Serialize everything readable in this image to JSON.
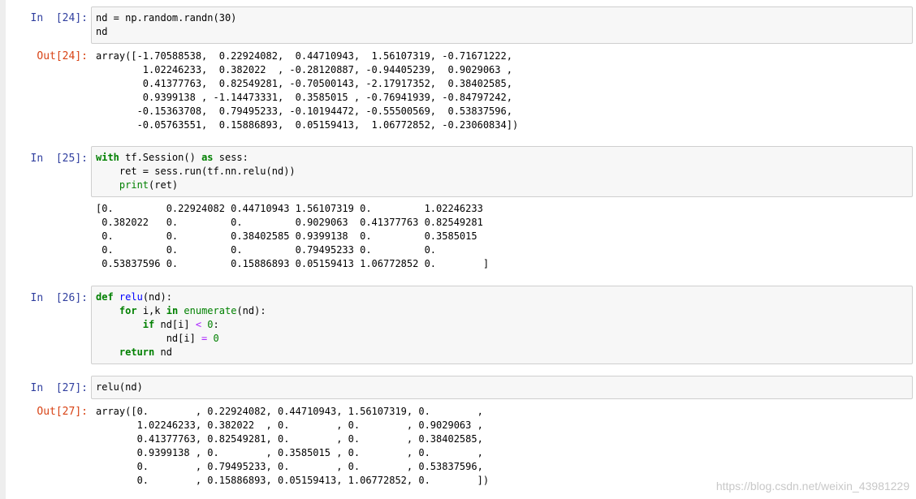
{
  "cells": [
    {
      "in_prompt": "In  [24]:",
      "code": [
        "nd = np.random.randn(30)",
        "nd"
      ],
      "out_prompt": "Out[24]:",
      "output": [
        "array([-1.70588538,  0.22924082,  0.44710943,  1.56107319, -0.71671222,",
        "        1.02246233,  0.382022  , -0.28120887, -0.94405239,  0.9029063 ,",
        "        0.41377763,  0.82549281, -0.70500143, -2.17917352,  0.38402585,",
        "        0.9399138 , -1.14473331,  0.3585015 , -0.76941939, -0.84797242,",
        "       -0.15363708,  0.79495233, -0.10194472, -0.55500569,  0.53837596,",
        "       -0.05763551,  0.15886893,  0.05159413,  1.06772852, -0.23060834])"
      ]
    },
    {
      "in_prompt": "In  [25]:",
      "code": [
        "with tf.Session() as sess:",
        "    ret = sess.run(tf.nn.relu(nd))",
        "    print(ret)"
      ],
      "output": [
        "[0.         0.22924082 0.44710943 1.56107319 0.         1.02246233",
        " 0.382022   0.         0.         0.9029063  0.41377763 0.82549281",
        " 0.         0.         0.38402585 0.9399138  0.         0.3585015",
        " 0.         0.         0.         0.79495233 0.         0.",
        " 0.53837596 0.         0.15886893 0.05159413 1.06772852 0.        ]"
      ]
    },
    {
      "in_prompt": "In  [26]:",
      "code": [
        "def relu(nd):",
        "    for i,k in enumerate(nd):",
        "        if nd[i] < 0:",
        "            nd[i] = 0",
        "    return nd"
      ]
    },
    {
      "in_prompt": "In  [27]:",
      "code": [
        "relu(nd)"
      ],
      "out_prompt": "Out[27]:",
      "output": [
        "array([0.        , 0.22924082, 0.44710943, 1.56107319, 0.        ,",
        "       1.02246233, 0.382022  , 0.        , 0.        , 0.9029063 ,",
        "       0.41377763, 0.82549281, 0.        , 0.        , 0.38402585,",
        "       0.9399138 , 0.        , 0.3585015 , 0.        , 0.        ,",
        "       0.        , 0.79495233, 0.        , 0.        , 0.53837596,",
        "       0.        , 0.15886893, 0.05159413, 1.06772852, 0.        ])"
      ]
    }
  ],
  "watermark": "https://blog.csdn.net/weixin_43981229",
  "colors": {
    "prompt_in": "#303f9f",
    "prompt_out": "#d84315",
    "keyword": "#008000"
  }
}
